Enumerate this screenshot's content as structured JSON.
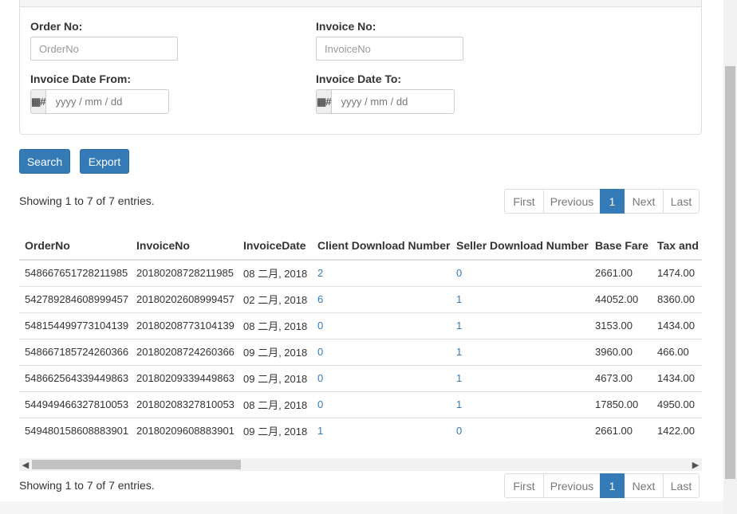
{
  "filters": {
    "order_no": {
      "label": "Order No:",
      "placeholder": "OrderNo"
    },
    "invoice_no": {
      "label": "Invoice No:",
      "placeholder": "InvoiceNo"
    },
    "date_from": {
      "label": "Invoice Date From:",
      "addon": "▦#",
      "placeholder": "yyyy / mm / dd"
    },
    "date_to": {
      "label": "Invoice Date To:",
      "addon": "▦#",
      "placeholder": "yyyy / mm / dd"
    }
  },
  "actions": {
    "search": "Search",
    "export": "Export"
  },
  "entries_info": "Showing 1 to 7 of 7 entries.",
  "pagination": {
    "first": "First",
    "previous": "Previous",
    "current": "1",
    "next": "Next",
    "last": "Last"
  },
  "table": {
    "columns": [
      "OrderNo",
      "InvoiceNo",
      "InvoiceDate",
      "Client Download Number",
      "Seller Download Number",
      "Base Fare",
      "Tax and"
    ],
    "rows": [
      [
        "548667651728211985",
        "20180208728211985",
        "08 二月, 2018",
        "2",
        "0",
        "2661.00",
        "1474.00"
      ],
      [
        "542789284608999457",
        "20180202608999457",
        "02 二月, 2018",
        "6",
        "1",
        "44052.00",
        "8360.00"
      ],
      [
        "548154499773104139",
        "20180208773104139",
        "08 二月, 2018",
        "0",
        "1",
        "3153.00",
        "1434.00"
      ],
      [
        "548667185724260366",
        "20180208724260366",
        "09 二月, 2018",
        "0",
        "1",
        "3960.00",
        "466.00"
      ],
      [
        "548662564339449863",
        "20180209339449863",
        "09 二月, 2018",
        "0",
        "1",
        "4673.00",
        "1434.00"
      ],
      [
        "544949466327810053",
        "20180208327810053",
        "08 二月, 2018",
        "0",
        "1",
        "17850.00",
        "4950.00"
      ],
      [
        "549480158608883901",
        "20180209608883901",
        "09 二月, 2018",
        "1",
        "0",
        "2661.00",
        "1422.00"
      ]
    ]
  },
  "colors": {
    "primary": "#337ab7",
    "link": "#337ab7",
    "border": "#dddddd"
  }
}
